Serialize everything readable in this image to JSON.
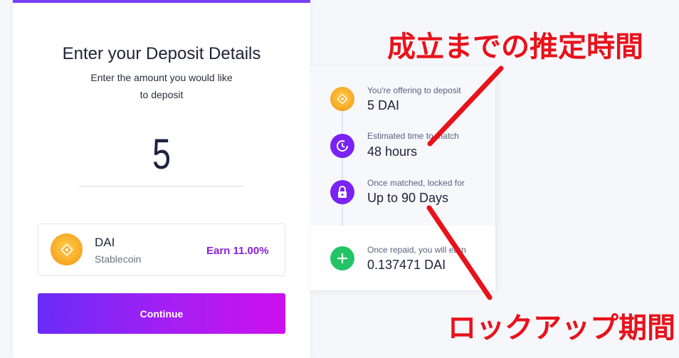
{
  "deposit_form": {
    "title": "Enter your Deposit Details",
    "subtitle": "Enter the amount you would like to deposit",
    "amount_value": "5",
    "token": {
      "name": "DAI",
      "type": "Stablecoin",
      "earn": "Earn 11.00%"
    },
    "continue_label": "Continue"
  },
  "summary": {
    "offering_label": "You're offering to deposit",
    "offering_value": "5 DAI",
    "estimated_label": "Estimated time to match",
    "estimated_value": "48 hours",
    "locked_label": "Once matched, locked for",
    "locked_value": "Up to 90 Days",
    "repaid_label": "Once repaid, you will earn",
    "repaid_value": "0.137471 DAI"
  },
  "annotations": {
    "top": "成立までの推定時間",
    "bottom": "ロックアップ期間"
  },
  "colors": {
    "accent_purple": "#7b22f5",
    "earn_purple": "#8a1fe0",
    "green": "#22c466",
    "annotation_red": "#e8121b",
    "coin_gold": "#f6a623"
  },
  "icons": {
    "dai": "dai-diamond-icon",
    "clock": "clock-icon",
    "lock": "lock-icon",
    "plus": "plus-icon"
  }
}
